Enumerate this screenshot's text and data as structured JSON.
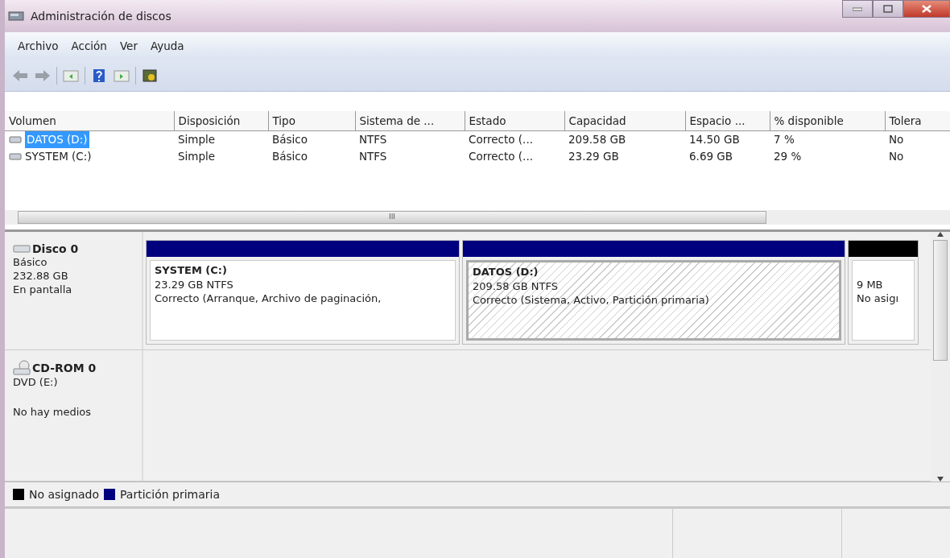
{
  "window": {
    "title": "Administración de discos"
  },
  "menu": [
    "Archivo",
    "Acción",
    "Ver",
    "Ayuda"
  ],
  "volumes": {
    "columns": [
      "Volumen",
      "Disposición",
      "Tipo",
      "Sistema de ...",
      "Estado",
      "Capacidad",
      "Espacio ...",
      "% disponible",
      "Tolera"
    ],
    "rows": [
      {
        "selected": true,
        "cells": [
          "DATOS (D:)",
          "Simple",
          "Básico",
          "NTFS",
          "Correcto (...",
          "209.58 GB",
          "14.50 GB",
          "7 %",
          "No"
        ]
      },
      {
        "selected": false,
        "cells": [
          "SYSTEM (C:)",
          "Simple",
          "Básico",
          "NTFS",
          "Correcto (...",
          "23.29 GB",
          "6.69 GB",
          "29 %",
          "No"
        ]
      }
    ],
    "scroll_mark": "III"
  },
  "disks": [
    {
      "kind": "disk",
      "name": "Disco 0",
      "lines": [
        "Básico",
        "232.88 GB",
        "En pantalla"
      ],
      "partitions": [
        {
          "kind": "primary",
          "selected": false,
          "name": "SYSTEM  (C:)",
          "size": "23.29 GB NTFS",
          "status": "Correcto (Arranque, Archivo de paginación,"
        },
        {
          "kind": "primary",
          "selected": true,
          "name": "DATOS  (D:)",
          "size": "209.58 GB NTFS",
          "status": "Correcto (Sistema, Activo, Partición primaria)"
        },
        {
          "kind": "unallocated",
          "selected": false,
          "size": "9 MB",
          "status": "No asigı"
        }
      ]
    },
    {
      "kind": "cdrom",
      "name": "CD-ROM 0",
      "lines": [
        "DVD (E:)",
        "No hay medios"
      ]
    }
  ],
  "legend": [
    {
      "label": "No asignado",
      "color": "#000000"
    },
    {
      "label": "Partición primaria",
      "color": "#00007f"
    }
  ]
}
